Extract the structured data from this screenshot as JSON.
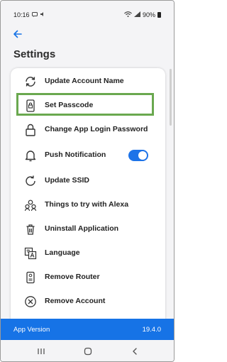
{
  "status_bar": {
    "time": "10:16",
    "left_icons": [
      "message-icon",
      "volume-icon"
    ],
    "right_icons": [
      "wifi-icon",
      "signal-icon"
    ],
    "battery": "90%"
  },
  "page": {
    "title": "Settings"
  },
  "settings": {
    "items": [
      {
        "label": "Update Account Name",
        "icon": "refresh-icon"
      },
      {
        "label": "Set Passcode",
        "icon": "lock-phone-icon",
        "highlighted": true
      },
      {
        "label": "Change App Login Password",
        "icon": "lock-icon"
      },
      {
        "label": "Push Notification",
        "icon": "bell-icon",
        "toggle": true,
        "toggle_on": true
      },
      {
        "label": "Update SSID",
        "icon": "refresh-circle-icon"
      },
      {
        "label": "Things to try with Alexa",
        "icon": "people-icon"
      },
      {
        "label": "Uninstall Application",
        "icon": "trash-icon"
      },
      {
        "label": "Language",
        "icon": "translate-icon"
      },
      {
        "label": "Remove Router",
        "icon": "router-icon"
      },
      {
        "label": "Remove Account",
        "icon": "remove-circle-icon"
      }
    ]
  },
  "footer": {
    "app_version_label": "App Version",
    "app_version_value": "19.4.0"
  },
  "colors": {
    "accent": "#1673e6",
    "highlight_border": "#6aa84f",
    "toggle_on": "#1d73e8"
  },
  "navbar": {
    "buttons": [
      "recent-apps-icon",
      "home-icon",
      "back-icon"
    ]
  }
}
